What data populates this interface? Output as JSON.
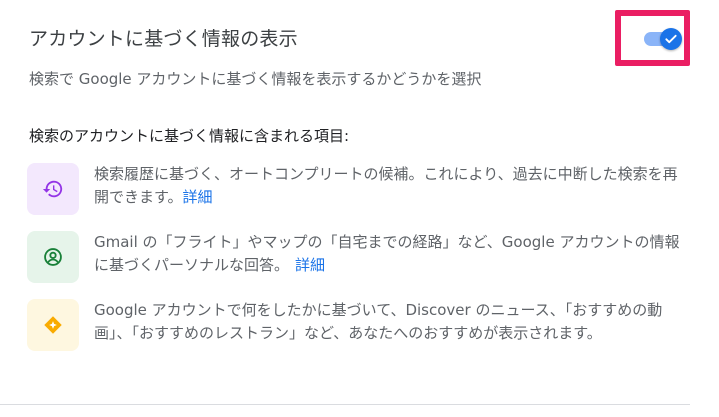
{
  "setting": {
    "title": "アカウントに基づく情報の表示",
    "description": "検索で Google アカウントに基づく情報を表示するかどうかを選択",
    "toggle_on": true,
    "accent_color": "#1a73e8",
    "highlight_color": "#ea1e63"
  },
  "section": {
    "heading": "検索のアカウントに基づく情報に含まれる項目:"
  },
  "items": [
    {
      "icon": "history-icon",
      "icon_color": "#9334e6",
      "icon_bg": "#f3e8fd",
      "text": "検索履歴に基づく、オートコンプリートの候補。これにより、過去に中断した検索を再開できます。",
      "link": "詳細"
    },
    {
      "icon": "account-circle-icon",
      "icon_color": "#188038",
      "icon_bg": "#e6f4ea",
      "text": "Gmail の「フライト」やマップの「自宅までの経路」など、Google アカウントの情報に基づくパーソナルな回答。",
      "link": "詳細"
    },
    {
      "icon": "discover-icon",
      "icon_color": "#f9ab00",
      "icon_bg": "#fef7e0",
      "text": "Google アカウントで何をしたかに基づいて、Discover のニュース、「おすすめの動画」、「おすすめのレストラン」など、あなたへのおすすめが表示されます。",
      "link": ""
    }
  ]
}
